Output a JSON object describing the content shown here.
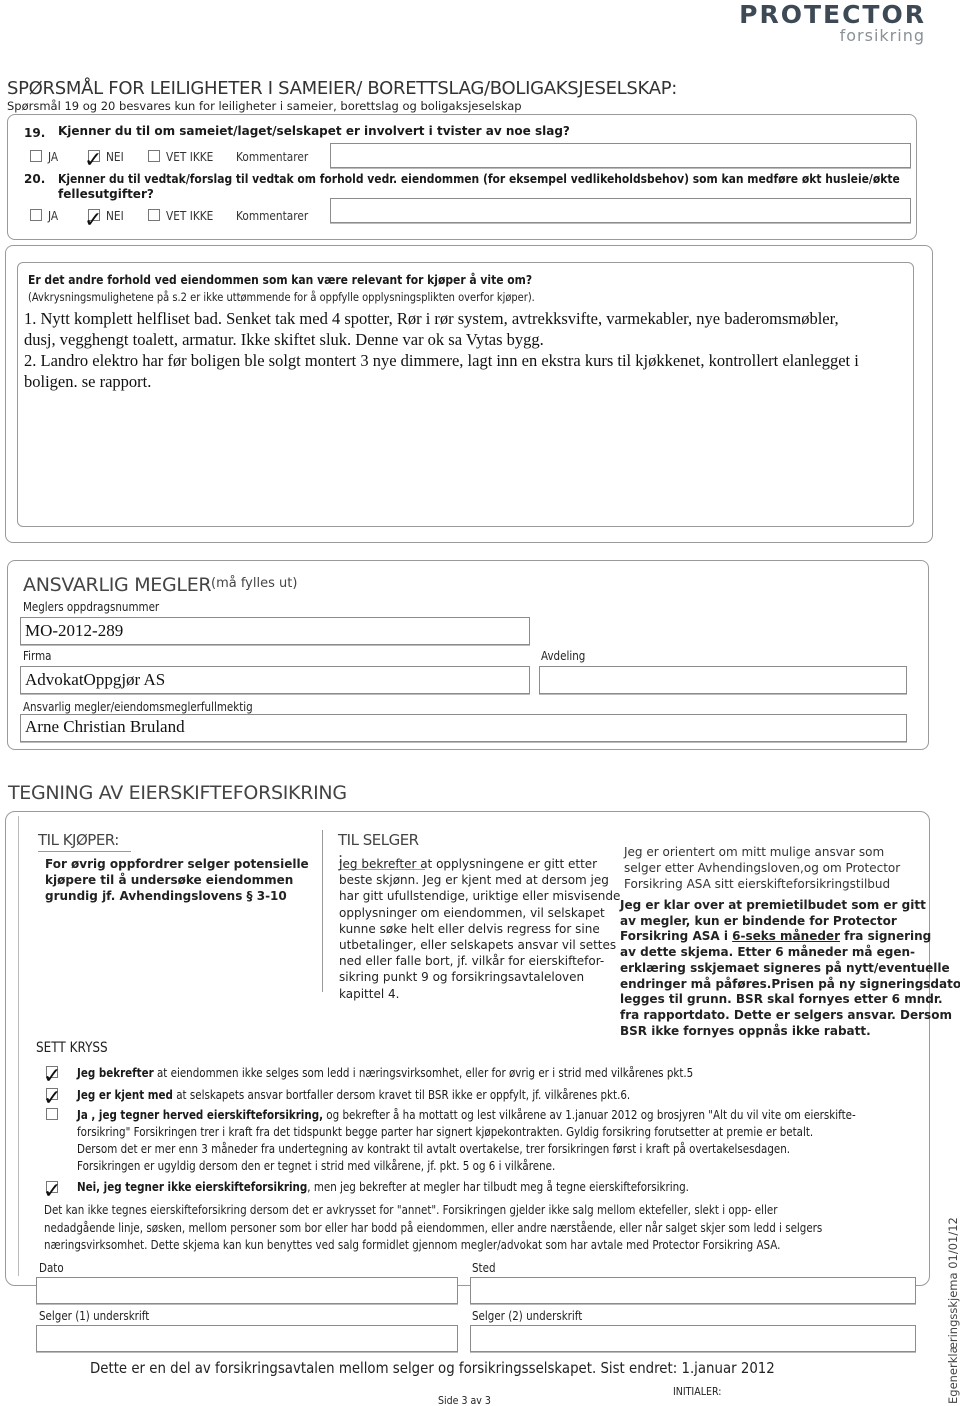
{
  "logo": {
    "name": "PROTECTOR",
    "sub": "forsikring"
  },
  "section_apartments": {
    "title": "SPØRSMÅL FOR LEILIGHETER I SAMEIER/ BORETTSLAG/BOLIGAKSJESELSKAP:",
    "subtitle": "Spørsmål 19 og 20 besvares kun for leiligheter i sameier, borettslag og boligaksjeselskap",
    "questions": [
      {
        "number": "19.",
        "text": "Kjenner du til  om sameiet/laget/selskapet er involvert i tvister av noe slag?",
        "text_cont": "",
        "options": [
          {
            "label": "JA",
            "checked": false
          },
          {
            "label": "NEI",
            "checked": true
          },
          {
            "label": "VET IKKE",
            "checked": false
          }
        ],
        "comment_label": "Kommentarer",
        "comment_value": ""
      },
      {
        "number": "20.",
        "text": "Kjenner  du til vedtak/forslag  til vedtak om forhold vedr. eiendommen (for eksempel vedlikeholdsbehov)  som kan medføre økt husleie/økte",
        "text_cont": "fellesutgifter?",
        "options": [
          {
            "label": "JA",
            "checked": false
          },
          {
            "label": "NEI",
            "checked": true
          },
          {
            "label": "VET IKKE",
            "checked": false
          }
        ],
        "comment_label": "Kommentarer",
        "comment_value": ""
      }
    ]
  },
  "other_conditions": {
    "question": "Er det andre forhold ved eiendommen som kan være relevant for kjøper å vite om?",
    "note": "(Avkrysningsmulighetene på s.2 er ikke uttømmende for å oppfylle opplysningsplikten overfor kjøper).",
    "answer_lines": [
      "1. Nytt komplett helfliset bad. Senket tak med 4 spotter, Rør i rør system, avtrekksvifte, varmekabler, nye baderomsmøbler,",
      "dusj, vegghengt toalett, armatur. Ikke skiftet sluk. Denne var ok sa Vytas bygg.",
      "2. Landro elektro har før boligen ble solgt montert 3 nye dimmere, lagt inn en ekstra kurs til kjøkkenet, kontrollert elanlegget i",
      "boligen. se rapport."
    ]
  },
  "broker": {
    "title": "ANSVARLIG MEGLER",
    "title_note": "(må fylles ut)",
    "assignment_label": "Meglers oppdragsnummer",
    "assignment_value": "MO-2012-289",
    "firm_label": "Firma",
    "firm_value": "AdvokatOppgjør AS",
    "department_label": "Avdeling",
    "department_value": "",
    "responsible_label": "Ansvarlig megler/eiendomsmeglerfullmektig",
    "responsible_value": "Arne Christian Bruland"
  },
  "insurance": {
    "title": "TEGNING AV EIERSKIFTEFORSIKRING",
    "buyer_title": "TIL KJØPER:",
    "buyer_lines": [
      "For øvrig oppfordrer selger potensielle",
      "kjøpere til å undersøke eiendommen",
      "grundig jf. Avhendingslovens § 3-10"
    ],
    "seller_title": "TIL SELGER :",
    "seller_lines": [
      "Jeg bekrefter at opplysningene er gitt etter",
      "beste skjønn. Jeg er kjent med at dersom jeg",
      "har gitt ufullstendige, uriktige eller misvisende",
      "opplysninger om eiendommen, vil selskapet",
      "kunne søke helt eller delvis regress for sine",
      "utbetalinger, eller selskapets ansvar vil settes",
      "ned eller falle bort, jf. vilkår for eierskiftefor-",
      "sikring punkt 9 og forsikringsavtaleloven",
      "kapittel 4."
    ],
    "oriented_lines": [
      "Jeg er orientert om mitt mulige ansvar som",
      "selger etter Avhendingsloven,og om Protector",
      "Forsikring ASA sitt eierskifteforsikringstilbud"
    ],
    "premium_lines": [
      "Jeg er klar over at premietilbudet som er gitt",
      "av megler, kun er bindende for Protector",
      "Forsikring ASA i ",
      "av dette skjema. Etter 6 måneder må egen-",
      "erklæring sskjemaet signeres på nytt/eventuelle",
      "endringer må påføres.Prisen på ny signeringsdato",
      "legges til grunn. BSR skal fornyes etter 6 mndr.",
      "fra rapportdato. Dette er selgers ansvar. Dersom",
      "BSR ikke fornyes oppnås ikke rabatt."
    ],
    "premium_underlined": "6-seks måneder",
    "premium_after": " fra signering",
    "sett_kryss": "SETT KRYSS",
    "checks": [
      {
        "checked": true,
        "bold": "Jeg bekrefter",
        "text": " at eiendommen ikke selges som ledd i næringsvirksomhet, eller for øvrig er i strid med vilkårenes pkt.5"
      },
      {
        "checked": true,
        "bold": "Jeg er kjent med",
        "text": " at selskapets ansvar bortfaller dersom kravet til BSR ikke er oppfylt, jf. vilkårenes pkt.6."
      },
      {
        "checked": false,
        "bold": "Ja , jeg tegner herved eierskifteforsikring,",
        "text": " og bekrefter å ha mottatt og lest vilkårene av 1.januar 2012 og brosjyren \"Alt du vil vite om eierskifte-",
        "more": [
          "forsikring\" Forsikringen trer i kraft fra det tidspunkt begge parter har signert kjøpekontrakten. Gyldig forsikring forutsetter at premie er betalt.",
          "Dersom det er mer enn 3 måneder fra undertegning av kontrakt til avtalt overtakelse, trer forsikringen først i kraft på overtakelsesdagen.",
          "Forsikringen er ugyldig dersom den er tegnet i strid med vilkårene, jf. pkt. 5 og 6 i vilkårene."
        ]
      },
      {
        "checked": true,
        "bold": "Nei, jeg  tegner ikke  eierskifteforsikring",
        "text": ", men jeg bekrefter at megler har tilbudt meg å tegne eierskifteforsikring."
      }
    ],
    "disclaimer_lines": [
      "Det kan ikke tegnes eierskifteforsikring dersom det er avkrysset for \"annet\". Forsikringen gjelder ikke salg mellom ektefeller, slekt i opp- eller",
      "nedadgående linje, søsken, mellom personer som bor eller har bodd på eiendommen, eller andre nærstående, eller når salget skjer som ledd i selgers",
      "næringsvirksomhet. Dette skjema kan kun benyttes ved salg formidlet gjennom megler/advokat som har avtale med Protector Forsikring ASA."
    ],
    "date_label": "Dato",
    "place_label": "Sted",
    "seller1_label": "Selger (1) underskrift",
    "seller2_label": "Selger (2) underskrift"
  },
  "footer": {
    "agreement": "Dette er en del av forsikringsavtalen mellom selger og forsikringsselskapet. Sist endret: 1.januar 2012",
    "initials": "INITIALER:",
    "page": "Side 3 av 3",
    "side_label": "Egenerklæringsskjema 01/01/12"
  },
  "glyphs": {
    "check": "✓"
  }
}
